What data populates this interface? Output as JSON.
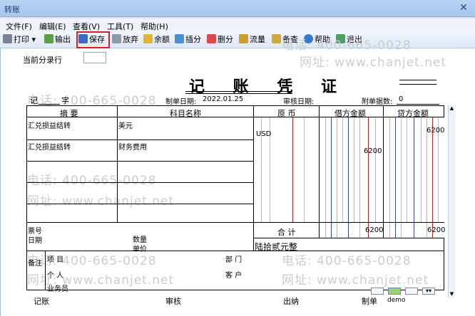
{
  "window": {
    "title": "转账"
  },
  "menu": [
    "文件(F)",
    "编辑(E)",
    "查看(V)",
    "工具(T)",
    "帮助(H)"
  ],
  "toolbar": {
    "print": "打印",
    "export": "输出",
    "save": "保存",
    "abandon": "放弃",
    "balance": "余额",
    "insert": "插分",
    "delete": "删分",
    "flow": "流量",
    "backup": "备查",
    "help": "帮助",
    "exit": "退出"
  },
  "entry_row_label": "当前分录行",
  "voucher": {
    "title": "记 账 凭 证",
    "type_label": "记",
    "word_label": "字",
    "date_label": "制单日期:",
    "date_value": "2022.01.25",
    "audit_label": "审核日期:",
    "attach_label": "附单据数:",
    "attach_value": "0",
    "headers": [
      "摘 要",
      "科目名称",
      "原 币",
      "借方金额",
      "贷方金额"
    ],
    "rows": [
      {
        "summary": "汇兑损益结转",
        "account": "美元",
        "currency": "USD",
        "debit": "",
        "credit": "6200"
      },
      {
        "summary": "汇兑损益结转",
        "account": "财务费用",
        "currency": "",
        "debit": "6200",
        "credit": ""
      }
    ],
    "ticket_label": "票号",
    "date2_label": "日期",
    "qty_label": "数量",
    "price_label": "单价",
    "total_label": "合 计",
    "total_debit": "6200",
    "total_credit": "6200",
    "total_words": "陆拾贰元整",
    "remark_label": "备注",
    "project_label": "项 目",
    "dept_label": "部 门",
    "person_label": "个 人",
    "customer_label": "客 户",
    "salesman_label": "业务员",
    "footer": {
      "bookkeeper": "记账",
      "auditor": "审核",
      "cashier": "出纳",
      "maker": "制单",
      "maker_value": "demo"
    }
  },
  "watermarks": [
    "电话: 400-665-0028",
    "网址: www.chanjet.net"
  ]
}
